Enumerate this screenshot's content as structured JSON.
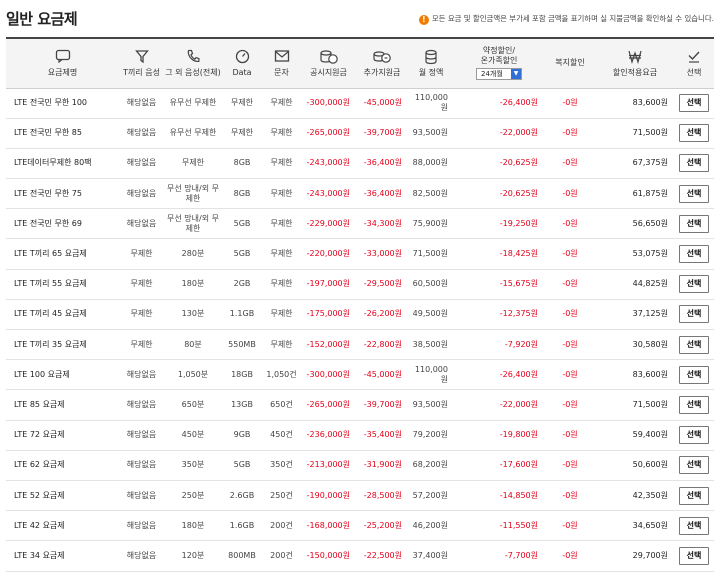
{
  "header": {
    "title": "일반 요금제",
    "notice": "모든 요금 및 할인금액은 부가세 포함 금액을 표기하며 실 지불금액을 확인하실 수 있습니다."
  },
  "columns": {
    "plan": "요금제명",
    "t_voice": "T끼리 음성",
    "other_voice": "그 외 음성(전체)",
    "data": "Data",
    "sms": "문자",
    "public_subsidy": "공시지원금",
    "extra_subsidy": "추가지원금",
    "monthly_fee": "월 정액",
    "contract_line1": "약정할인/",
    "contract_line2": "온가족할인",
    "contract_term": "24개월",
    "welfare": "복지할인",
    "discounted_fee": "할인적용요금",
    "select": "선택"
  },
  "select_label": "선택",
  "rows": [
    {
      "plan": "LTE 전국민 무한 100",
      "t_voice": "해당없음",
      "other_voice": "유무선 무제한",
      "data": "무제한",
      "sms": "무제한",
      "public_subsidy": "-300,000원",
      "extra_subsidy": "-45,000원",
      "monthly_fee": "110,000원",
      "contract": "-26,400원",
      "welfare": "-0원",
      "final": "83,600원"
    },
    {
      "plan": "LTE 전국민 무한 85",
      "t_voice": "해당없음",
      "other_voice": "유무선 무제한",
      "data": "무제한",
      "sms": "무제한",
      "public_subsidy": "-265,000원",
      "extra_subsidy": "-39,700원",
      "monthly_fee": "93,500원",
      "contract": "-22,000원",
      "welfare": "-0원",
      "final": "71,500원"
    },
    {
      "plan": "LTE데이터무제한 80팩",
      "t_voice": "해당없음",
      "other_voice": "무제한",
      "data": "8GB",
      "sms": "무제한",
      "public_subsidy": "-243,000원",
      "extra_subsidy": "-36,400원",
      "monthly_fee": "88,000원",
      "contract": "-20,625원",
      "welfare": "-0원",
      "final": "67,375원"
    },
    {
      "plan": "LTE 전국민 무한 75",
      "t_voice": "해당없음",
      "other_voice": "무선 망내/외 무제한",
      "data": "8GB",
      "sms": "무제한",
      "public_subsidy": "-243,000원",
      "extra_subsidy": "-36,400원",
      "monthly_fee": "82,500원",
      "contract": "-20,625원",
      "welfare": "-0원",
      "final": "61,875원"
    },
    {
      "plan": "LTE 전국민 무한 69",
      "t_voice": "해당없음",
      "other_voice": "무선 망내/외 무제한",
      "data": "5GB",
      "sms": "무제한",
      "public_subsidy": "-229,000원",
      "extra_subsidy": "-34,300원",
      "monthly_fee": "75,900원",
      "contract": "-19,250원",
      "welfare": "-0원",
      "final": "56,650원"
    },
    {
      "plan": "LTE T끼리 65 요금제",
      "t_voice": "무제한",
      "other_voice": "280분",
      "data": "5GB",
      "sms": "무제한",
      "public_subsidy": "-220,000원",
      "extra_subsidy": "-33,000원",
      "monthly_fee": "71,500원",
      "contract": "-18,425원",
      "welfare": "-0원",
      "final": "53,075원"
    },
    {
      "plan": "LTE T끼리 55 요금제",
      "t_voice": "무제한",
      "other_voice": "180분",
      "data": "2GB",
      "sms": "무제한",
      "public_subsidy": "-197,000원",
      "extra_subsidy": "-29,500원",
      "monthly_fee": "60,500원",
      "contract": "-15,675원",
      "welfare": "-0원",
      "final": "44,825원"
    },
    {
      "plan": "LTE T끼리 45 요금제",
      "t_voice": "무제한",
      "other_voice": "130분",
      "data": "1.1GB",
      "sms": "무제한",
      "public_subsidy": "-175,000원",
      "extra_subsidy": "-26,200원",
      "monthly_fee": "49,500원",
      "contract": "-12,375원",
      "welfare": "-0원",
      "final": "37,125원"
    },
    {
      "plan": "LTE T끼리 35 요금제",
      "t_voice": "무제한",
      "other_voice": "80분",
      "data": "550MB",
      "sms": "무제한",
      "public_subsidy": "-152,000원",
      "extra_subsidy": "-22,800원",
      "monthly_fee": "38,500원",
      "contract": "-7,920원",
      "welfare": "-0원",
      "final": "30,580원"
    },
    {
      "plan": "LTE 100 요금제",
      "t_voice": "해당없음",
      "other_voice": "1,050분",
      "data": "18GB",
      "sms": "1,050건",
      "public_subsidy": "-300,000원",
      "extra_subsidy": "-45,000원",
      "monthly_fee": "110,000원",
      "contract": "-26,400원",
      "welfare": "-0원",
      "final": "83,600원"
    },
    {
      "plan": "LTE 85 요금제",
      "t_voice": "해당없음",
      "other_voice": "650분",
      "data": "13GB",
      "sms": "650건",
      "public_subsidy": "-265,000원",
      "extra_subsidy": "-39,700원",
      "monthly_fee": "93,500원",
      "contract": "-22,000원",
      "welfare": "-0원",
      "final": "71,500원"
    },
    {
      "plan": "LTE 72 요금제",
      "t_voice": "해당없음",
      "other_voice": "450분",
      "data": "9GB",
      "sms": "450건",
      "public_subsidy": "-236,000원",
      "extra_subsidy": "-35,400원",
      "monthly_fee": "79,200원",
      "contract": "-19,800원",
      "welfare": "-0원",
      "final": "59,400원"
    },
    {
      "plan": "LTE 62 요금제",
      "t_voice": "해당없음",
      "other_voice": "350분",
      "data": "5GB",
      "sms": "350건",
      "public_subsidy": "-213,000원",
      "extra_subsidy": "-31,900원",
      "monthly_fee": "68,200원",
      "contract": "-17,600원",
      "welfare": "-0원",
      "final": "50,600원"
    },
    {
      "plan": "LTE 52 요금제",
      "t_voice": "해당없음",
      "other_voice": "250분",
      "data": "2.6GB",
      "sms": "250건",
      "public_subsidy": "-190,000원",
      "extra_subsidy": "-28,500원",
      "monthly_fee": "57,200원",
      "contract": "-14,850원",
      "welfare": "-0원",
      "final": "42,350원"
    },
    {
      "plan": "LTE 42 요금제",
      "t_voice": "해당없음",
      "other_voice": "180분",
      "data": "1.6GB",
      "sms": "200건",
      "public_subsidy": "-168,000원",
      "extra_subsidy": "-25,200원",
      "monthly_fee": "46,200원",
      "contract": "-11,550원",
      "welfare": "-0원",
      "final": "34,650원"
    },
    {
      "plan": "LTE 34 요금제",
      "t_voice": "해당없음",
      "other_voice": "120분",
      "data": "800MB",
      "sms": "200건",
      "public_subsidy": "-150,000원",
      "extra_subsidy": "-22,500원",
      "monthly_fee": "37,400원",
      "contract": "-7,700원",
      "welfare": "-0원",
      "final": "29,700원"
    }
  ]
}
